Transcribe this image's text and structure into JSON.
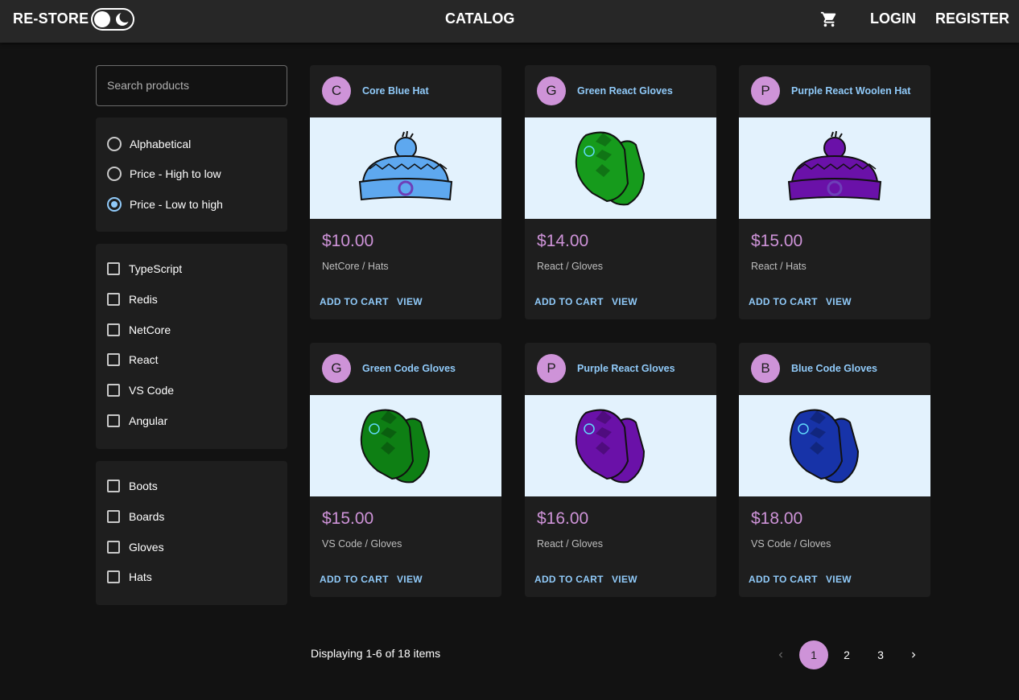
{
  "header": {
    "brand": "RE-STORE",
    "title": "CATALOG",
    "login": "LOGIN",
    "register": "REGISTER"
  },
  "sidebar": {
    "search_placeholder": "Search products",
    "sort_options": [
      {
        "label": "Alphabetical",
        "selected": false
      },
      {
        "label": "Price - High to low",
        "selected": false
      },
      {
        "label": "Price - Low to high",
        "selected": true
      }
    ],
    "brands": [
      "TypeScript",
      "Redis",
      "NetCore",
      "React",
      "VS Code",
      "Angular"
    ],
    "types": [
      "Boots",
      "Boards",
      "Gloves",
      "Hats"
    ]
  },
  "products": [
    {
      "initial": "C",
      "name": "Core Blue Hat",
      "price": "$10.00",
      "meta": "NetCore / Hats",
      "kind": "hat",
      "color": "#5ea8ef"
    },
    {
      "initial": "G",
      "name": "Green React Gloves",
      "price": "$14.00",
      "meta": "React / Gloves",
      "kind": "gloves",
      "color": "#169b1c"
    },
    {
      "initial": "P",
      "name": "Purple React Woolen Hat",
      "price": "$15.00",
      "meta": "React / Hats",
      "kind": "hat",
      "color": "#6a11a8"
    },
    {
      "initial": "G",
      "name": "Green Code Gloves",
      "price": "$15.00",
      "meta": "VS Code / Gloves",
      "kind": "gloves",
      "color": "#0e7f14"
    },
    {
      "initial": "P",
      "name": "Purple React Gloves",
      "price": "$16.00",
      "meta": "React / Gloves",
      "kind": "gloves",
      "color": "#6a11a8"
    },
    {
      "initial": "B",
      "name": "Blue Code Gloves",
      "price": "$18.00",
      "meta": "VS Code / Gloves",
      "kind": "gloves",
      "color": "#1733a8"
    }
  ],
  "card_actions": {
    "add": "ADD TO CART",
    "view": "VIEW"
  },
  "footer": {
    "display": "Displaying 1-6 of 18 items",
    "pages": [
      "1",
      "2",
      "3"
    ],
    "current_page": "1"
  },
  "colors": {
    "accent": "#ce93d8",
    "link": "#90caf9",
    "background": "#121212",
    "surface": "#1e1e1e"
  }
}
